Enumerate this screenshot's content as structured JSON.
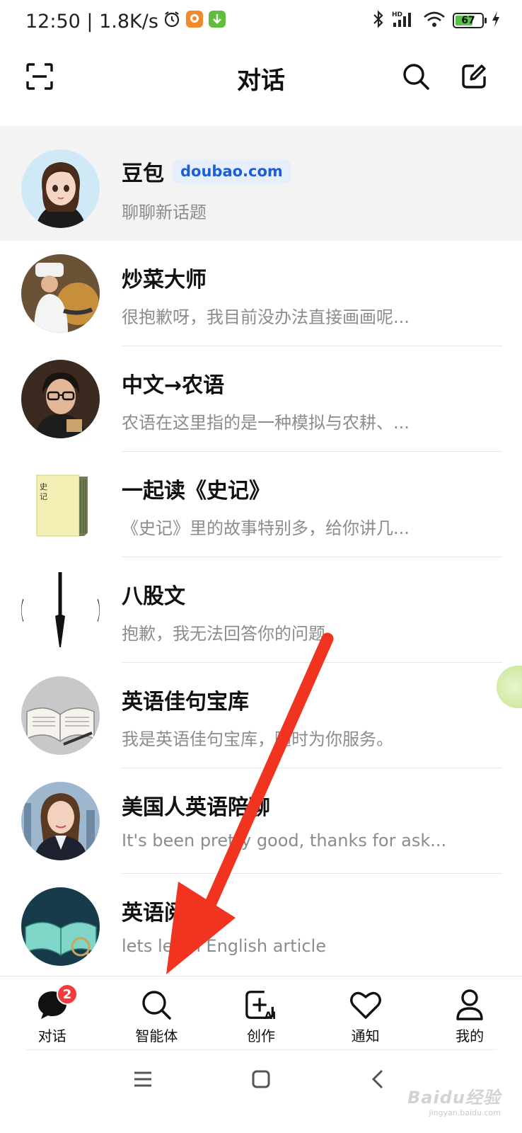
{
  "status_bar": {
    "time": "12:50 | 1.8K/s",
    "battery": "67",
    "battery_level": 0.67
  },
  "header": {
    "title": "对话",
    "icons": [
      "scan-icon",
      "search-icon",
      "compose-icon"
    ]
  },
  "conversations": [
    {
      "name": "豆包",
      "tag": "doubao.com",
      "preview": "聊聊新话题",
      "pinned": true,
      "avatar": "girl-avatar"
    },
    {
      "name": "炒菜大师",
      "preview": "很抱歉呀，我目前没办法直接画画呢...",
      "avatar": "chef-avatar"
    },
    {
      "name": "中文→农语",
      "preview": "农语在这里指的是一种模拟与农耕、...",
      "avatar": "scholar-avatar"
    },
    {
      "name": "一起读《史记》",
      "preview": "《史记》里的故事特别多，给你讲几...",
      "avatar": "book-shiji-avatar"
    },
    {
      "name": "八股文",
      "preview": "抱歉，我无法回答你的问题",
      "avatar": "brush-avatar"
    },
    {
      "name": "英语佳句宝库",
      "preview": "我是英语佳句宝库，随时为你服务。",
      "avatar": "open-book-avatar"
    },
    {
      "name": "美国人英语陪聊",
      "preview": "It's been pretty good, thanks for ask...",
      "avatar": "woman-avatar"
    },
    {
      "name": "英语阅读",
      "preview": "lets learn English article",
      "avatar": "reading-avatar"
    }
  ],
  "tabs": [
    {
      "label": "对话",
      "icon": "chat-icon",
      "badge": "2",
      "active": true
    },
    {
      "label": "智能体",
      "icon": "search-icon"
    },
    {
      "label": "创作",
      "icon": "create-ai-icon"
    },
    {
      "label": "通知",
      "icon": "heart-icon"
    },
    {
      "label": "我的",
      "icon": "profile-icon"
    }
  ],
  "watermark": {
    "logo": "Baidu经验",
    "url": "jingyan.baidu.com"
  },
  "colors": {
    "accent_red": "#f23b3b",
    "tag_blue": "#1a5fd6",
    "annotation_arrow": "#f0341f"
  }
}
